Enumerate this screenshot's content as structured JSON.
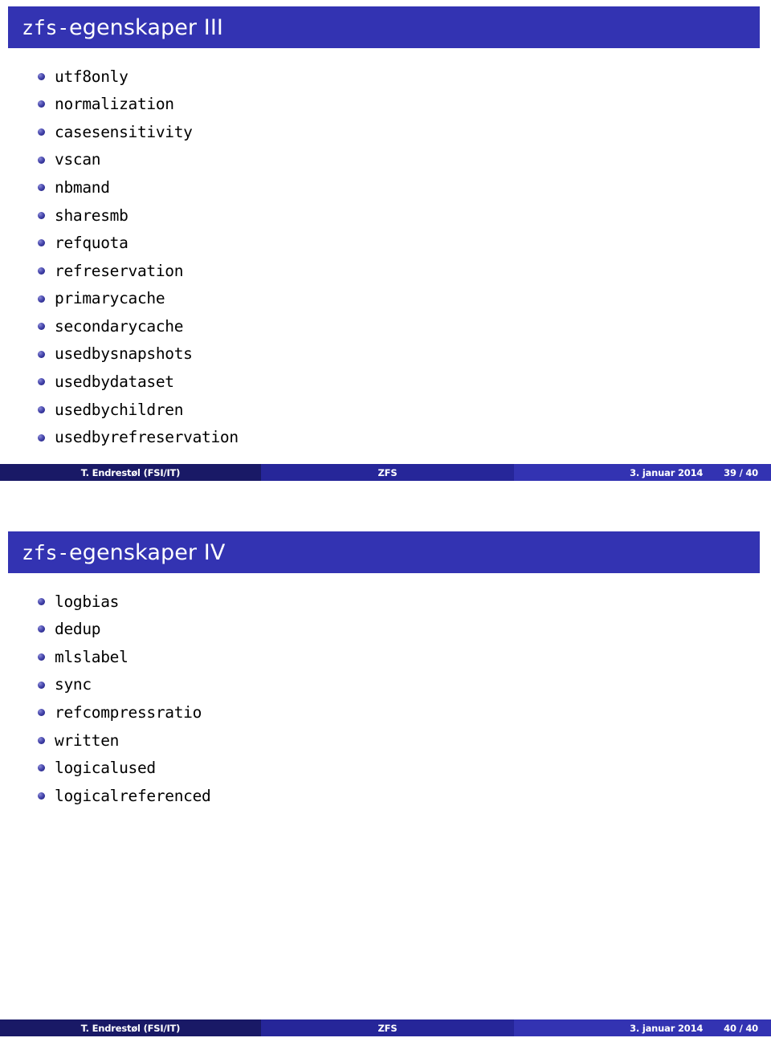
{
  "theme": {
    "title_bar_color": "#3333b2",
    "footer_author_color": "#191966",
    "footer_title_color": "#262699",
    "footer_date_color": "#3333b2",
    "bullet_color": "#3b3b9e",
    "text_color": "#000000"
  },
  "slides": [
    {
      "title_prefix": "zfs-",
      "title_suffix": "egenskaper III",
      "items": [
        "utf8only",
        "normalization",
        "casesensitivity",
        "vscan",
        "nbmand",
        "sharesmb",
        "refquota",
        "refreservation",
        "primarycache",
        "secondarycache",
        "usedbysnapshots",
        "usedbydataset",
        "usedbychildren",
        "usedbyrefreservation"
      ],
      "footer": {
        "author": "T. Endrestøl  (FSI/IT)",
        "title": "ZFS",
        "date": "3. januar 2014",
        "page": "39 / 40"
      }
    },
    {
      "title_prefix": "zfs-",
      "title_suffix": "egenskaper IV",
      "items": [
        "logbias",
        "dedup",
        "mlslabel",
        "sync",
        "refcompressratio",
        "written",
        "logicalused",
        "logicalreferenced"
      ],
      "footer": {
        "author": "T. Endrestøl  (FSI/IT)",
        "title": "ZFS",
        "date": "3. januar 2014",
        "page": "40 / 40"
      }
    }
  ]
}
